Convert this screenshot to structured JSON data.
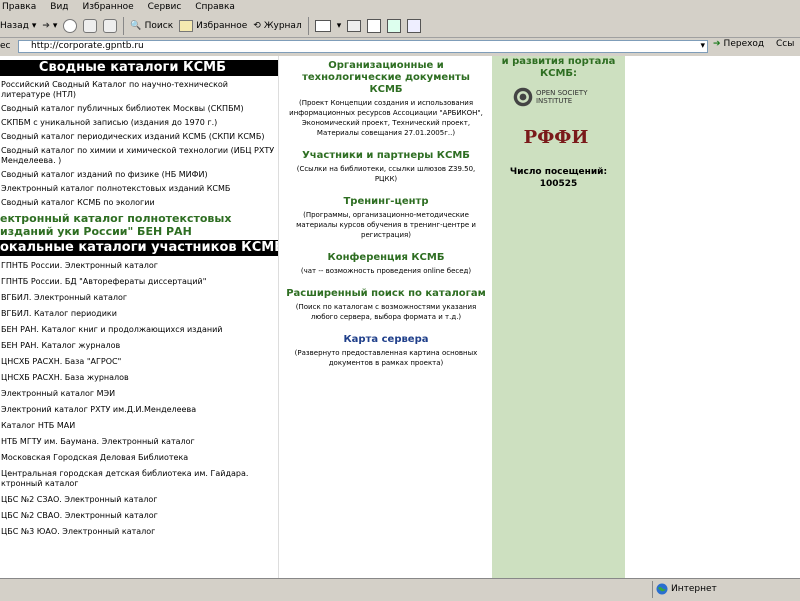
{
  "browser": {
    "menu": [
      "Правка",
      "Вид",
      "Избранное",
      "Сервис",
      "Справка"
    ],
    "toolbar": {
      "back": "Назад",
      "search": "Поиск",
      "favorites": "Избранное",
      "history": "Журнал"
    },
    "address": {
      "label": "ес",
      "url": "http://corporate.gpntb.ru",
      "go": "Переход",
      "links": "Ссы"
    },
    "status": {
      "zone": "Интернет"
    }
  },
  "left": {
    "header1": "Сводные каталоги КСМБ",
    "summary_items": [
      "Российский Сводный Каталог по научно-технической литературе (НТЛ)",
      "Сводный каталог публичных библиотек Москвы (СКПБМ)",
      "СКПБМ с уникальной записью (издания до 1970 г.)",
      "Сводный каталог периодических изданий КСМБ (СКПИ КСМБ)",
      "Сводный каталог по химии и химической технологии (ИБЦ РХТУ Менделеева. )",
      "Сводный каталог изданий по физике (НБ МИФИ)",
      "Электронный каталог полнотекстовых изданий КСМБ",
      "Сводный каталог КСМБ по экологии"
    ],
    "big_link": "ектронный каталог полнотекстовых изданий уки России\" БЕН РАН",
    "header2": "окальные каталоги участников КСМБ",
    "local_items": [
      "ГПНТБ России. Электронный каталог",
      "ГПНТБ России. БД \"Авторефераты диссертаций\"",
      "ВГБИЛ. Электронный каталог",
      "ВГБИЛ. Каталог периодики",
      "БЕН РАН. Каталог книг и продолжающихся изданий",
      "БЕН РАН. Каталог журналов",
      "ЦНСХБ РАСХН. База \"АГРОС\"",
      "ЦНСХБ РАСХН. База журналов",
      "Электронный каталог МЭИ",
      "Электроний каталог РХТУ им.Д.И.Менделеева",
      "Каталог НТБ МАИ",
      "НТБ МГТУ им. Баумана. Электронный каталог",
      "Московская Городская Деловая Библиотека",
      "Центральная городская детская библиотека им. Гайдара. ктронный каталог",
      "ЦБС №2 СЗАО. Электронный каталог",
      "ЦБС №2 СВАО. Электронный каталог",
      "ЦБС №3 ЮАО. Электронный каталог"
    ]
  },
  "middle": {
    "sections": [
      {
        "title": "Организационные и технологические документы КСМБ",
        "desc": "(Проект Концепции создания и использования информационных ресурсов Ассоциации \"АРБИКОН\", Экономический проект, Технический проект, Материалы совещания 27.01.2005г..)"
      },
      {
        "title": "Участники и партнеры КСМБ",
        "desc": "(Ссылки на библиотеки, ссылки шлюзов Z39.50, РЦКК)"
      },
      {
        "title": "Тренинг-центр",
        "desc": "(Программы, организационно-методические материалы курсов обучения в тренинг-центре и регистрация)"
      },
      {
        "title": "Конференция КСМБ",
        "desc": "(чат -- возможность проведения online бесед)"
      },
      {
        "title": "Расширенный поиск по каталогам",
        "desc": "(Поиск по каталогам с возможностями указания любого сервера, выбора формата и т.д.)"
      },
      {
        "title": "Карта сервера",
        "desc": "(Развернуто предоставленная картина основных документов в рамках проекта)"
      }
    ]
  },
  "right": {
    "top_text": "и развития портала КСМБ:",
    "logo1": "OPEN SOCIETY INSTITUTE",
    "logo2": "РФФИ",
    "visits_label": "Число посещений:",
    "visits_value": "100525"
  },
  "colors": {
    "chrome": "#d4d0c8",
    "green_text": "#2e6e22",
    "right_bg": "#cde0c0",
    "header_bg": "#000000"
  }
}
